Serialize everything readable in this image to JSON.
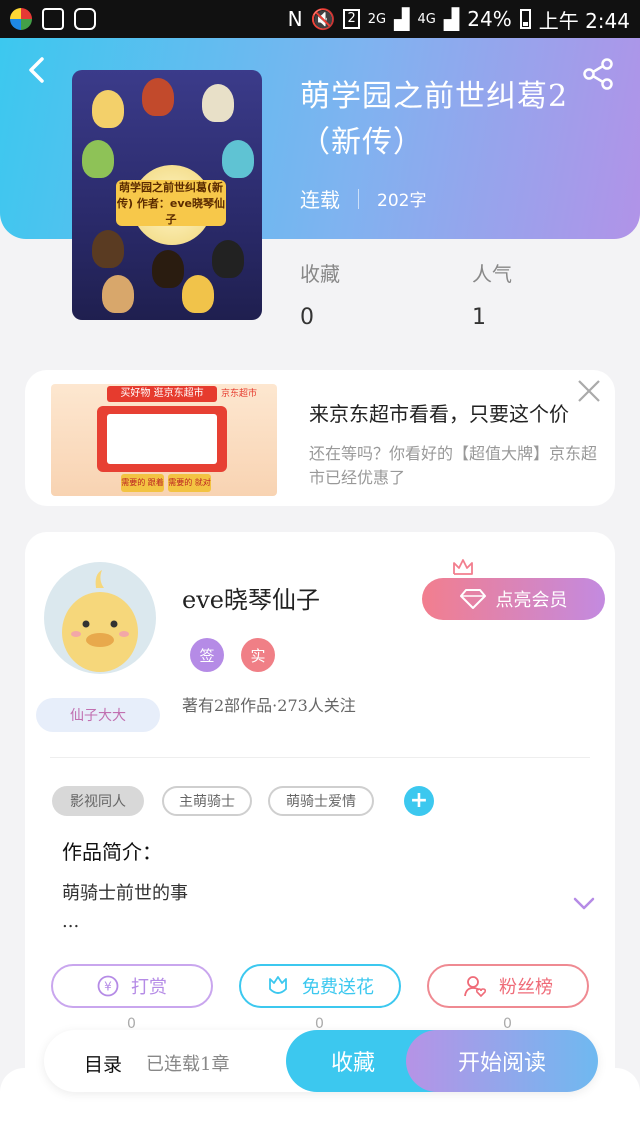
{
  "status_bar": {
    "signal_2g": "2G",
    "signal_4g": "4G",
    "battery": "24%",
    "time": "上午 2:44",
    "sim_badge": "2"
  },
  "book": {
    "title": "萌学园之前世纠葛2（新传）",
    "status": "连载",
    "word_count": "202字",
    "cover_caption": "萌学园之前世纠葛(新传) 作者：eve晓琴仙子",
    "favorites_label": "收藏",
    "favorites_value": "0",
    "popularity_label": "人气",
    "popularity_value": "1"
  },
  "ad": {
    "title": "来京东超市看看，只要这个价",
    "description": "还在等吗？你看好的【超值大牌】京东超市已经优惠了",
    "banner_text": "买好物 逛京东超市",
    "logo_text": "京东超市",
    "button_left": "需要的 跟着买",
    "button_right": "需要的 就对了"
  },
  "author": {
    "name": "eve晓琴仙子",
    "nick_badge": "仙子大大",
    "vip_button": "点亮会员",
    "tag_sign": "签",
    "tag_real": "实",
    "works_summary": "著有2部作品·273人关注"
  },
  "tags": [
    "影视同人",
    "主萌骑士",
    "萌骑士爱情"
  ],
  "intro": {
    "heading": "作品简介：",
    "text": "萌骑士前世的事",
    "ellipsis": "..."
  },
  "actions": [
    {
      "label": "打赏",
      "count": "0",
      "icon": "yen-icon",
      "color": "#b58be6"
    },
    {
      "label": "免费送花",
      "count": "0",
      "icon": "flower-icon",
      "color": "#3cc8ef"
    },
    {
      "label": "粉丝榜",
      "count": "0",
      "icon": "fans-icon",
      "color": "#ef6b78"
    }
  ],
  "bottom_bar": {
    "toc_label": "目录",
    "chapters": "已连载1章",
    "favorite_button": "收藏",
    "read_button": "开始阅读"
  },
  "colors": {
    "accent_blue": "#3cc8ef",
    "accent_purple": "#b193e8",
    "vip_pink": "#f27e8e",
    "tag_sign_color": "#b58be6",
    "tag_real_color": "#f07f86"
  }
}
